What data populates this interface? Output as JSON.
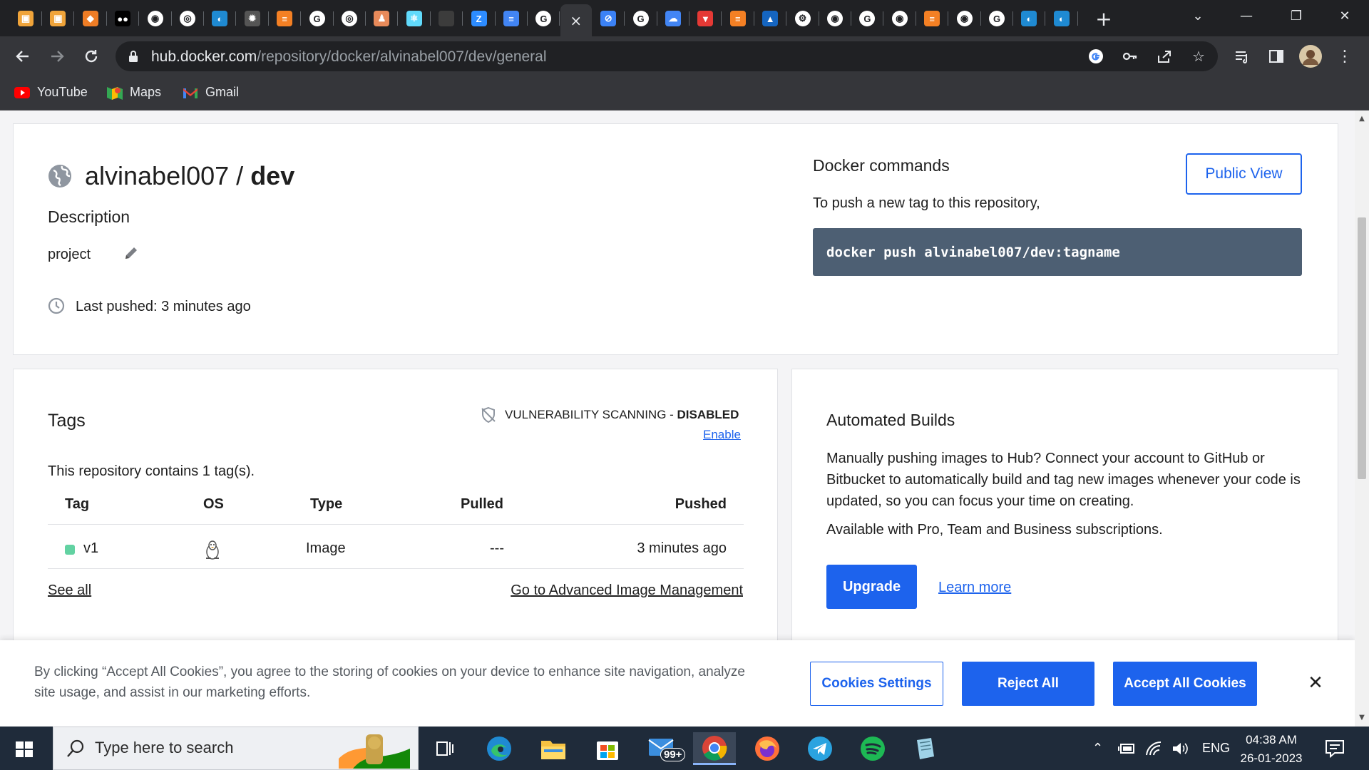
{
  "browser": {
    "active_tab_close": "×",
    "new_tab": "+",
    "url_host": "hub.docker.com",
    "url_path": "/repository/docker/alvinabel007/dev/general",
    "bookmarks": [
      {
        "label": "YouTube",
        "icon": "youtube-icon"
      },
      {
        "label": "Maps",
        "icon": "maps-icon"
      },
      {
        "label": "Gmail",
        "icon": "gmail-icon"
      }
    ]
  },
  "repo": {
    "owner": "alvinabel007",
    "separator": " / ",
    "name": "dev",
    "description_heading": "Description",
    "description": "project",
    "last_pushed": "Last pushed: 3 minutes ago"
  },
  "commands": {
    "heading": "Docker commands",
    "public_view": "Public View",
    "subtext": "To push a new tag to this repository,",
    "command": "docker push alvinabel007/dev:tagname"
  },
  "tags": {
    "heading": "Tags",
    "scan_label": "VULNERABILITY SCANNING - ",
    "scan_status": "DISABLED",
    "enable": "Enable",
    "summary": "This repository contains 1 tag(s).",
    "columns": [
      "Tag",
      "OS",
      "Type",
      "Pulled",
      "Pushed"
    ],
    "rows": [
      {
        "tag": "v1",
        "os": "linux-icon",
        "type": "Image",
        "pulled": "---",
        "pushed": "3 minutes ago",
        "status_color": "#62d2a2"
      }
    ],
    "see_all": "See all",
    "advanced": "Go to Advanced Image Management"
  },
  "builds": {
    "heading": "Automated Builds",
    "body": "Manually pushing images to Hub? Connect your account to GitHub or Bitbucket to automatically build and tag new images whenever your code is updated, so you can focus your time on creating.",
    "availability": "Available with Pro, Team and Business subscriptions.",
    "upgrade": "Upgrade",
    "learn_more": "Learn more"
  },
  "cookie": {
    "text": "By clicking “Accept All Cookies”, you agree to the storing of cookies on your device to enhance site navigation, analyze site usage, and assist in our marketing efforts.",
    "settings": "Cookies Settings",
    "reject": "Reject All",
    "accept": "Accept All Cookies",
    "close": "✕"
  },
  "taskbar": {
    "search_placeholder": "Type here to search",
    "mail_badge": "99+",
    "language": "ENG",
    "time": "04:38 AM",
    "date": "26-01-2023"
  },
  "colors": {
    "docker_blue": "#1d63ed",
    "command_bg": "#4d5f73",
    "chrome_dark": "#202124",
    "taskbar": "#1f2b3a"
  }
}
